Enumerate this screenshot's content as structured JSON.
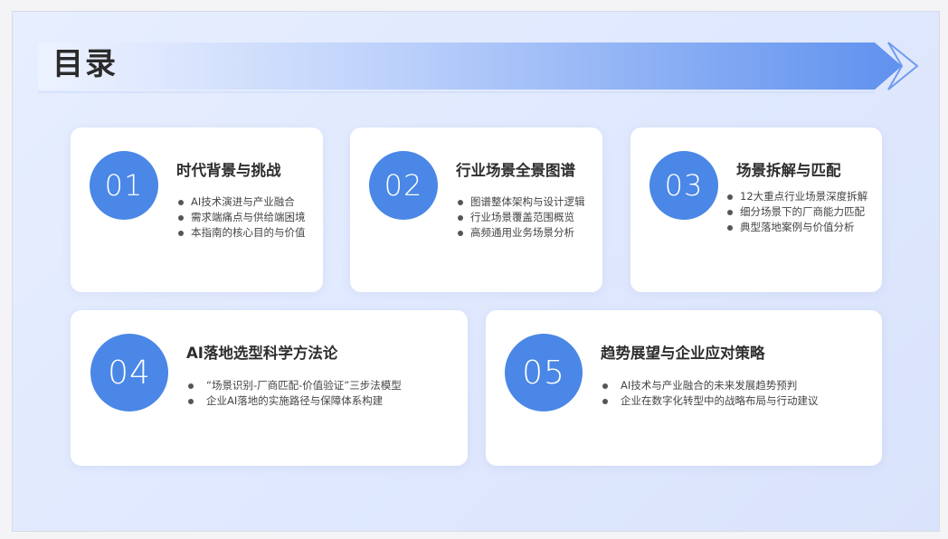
{
  "page": {
    "title": "目录"
  },
  "colors": {
    "accent": "#4a87e6",
    "banner_start": "#eaf1ff",
    "banner_end": "#6f9bf2",
    "background": "#e2eafc"
  },
  "sections": [
    {
      "number": "01",
      "title": "时代背景与挑战",
      "items": [
        "AI技术演进与产业融合",
        "需求端痛点与供给端困境",
        "本指南的核心目的与价值"
      ]
    },
    {
      "number": "02",
      "title": "行业场景全景图谱",
      "items": [
        "图谱整体架构与设计逻辑",
        "行业场景覆盖范围概览",
        "高频通用业务场景分析"
      ]
    },
    {
      "number": "03",
      "title": "场景拆解与匹配",
      "items": [
        "12大重点行业场景深度拆解",
        "细分场景下的厂商能力匹配",
        "典型落地案例与价值分析"
      ]
    },
    {
      "number": "04",
      "title": "AI落地选型科学方法论",
      "items": [
        "“场景识别-厂商匹配-价值验证”三步法模型",
        "企业AI落地的实施路径与保障体系构建"
      ]
    },
    {
      "number": "05",
      "title": "趋势展望与企业应对策略",
      "items": [
        "AI技术与产业融合的未来发展趋势预判",
        "企业在数字化转型中的战略布局与行动建议"
      ]
    }
  ]
}
